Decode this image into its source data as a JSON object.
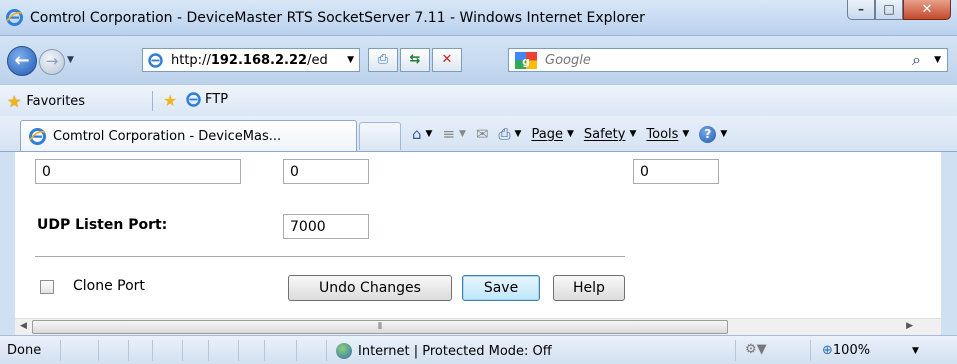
{
  "window": {
    "title": "Comtrol Corporation - DeviceMaster RTS SocketServer 7.11 - Windows Internet Explorer",
    "minimize_glyph": "–",
    "maximize_glyph": "□",
    "close_glyph": "✕"
  },
  "address_bar": {
    "url_prefix": "http://",
    "url_host": "192.168.2.22",
    "url_path": "/ed",
    "search_placeholder": "Google"
  },
  "favorites_bar": {
    "favorites_label": "Favorites",
    "links": [
      "FTP"
    ]
  },
  "tabs": [
    {
      "label": "Comtrol Corporation - DeviceMas..."
    }
  ],
  "command_bar": {
    "page_label": "Page",
    "safety_label": "Safety",
    "tools_label": "Tools"
  },
  "form": {
    "row1_values": [
      "0",
      "0",
      "0"
    ],
    "udp_listen_port_label": "UDP Listen Port:",
    "udp_listen_port_value": "7000",
    "clone_port_label": "Clone Port",
    "clone_port_checked": false,
    "undo_button": "Undo Changes",
    "save_button": "Save",
    "help_button": "Help"
  },
  "status_bar": {
    "status_text": "Done",
    "zone_text": "Internet | Protected Mode: Off",
    "zoom": "100%"
  }
}
